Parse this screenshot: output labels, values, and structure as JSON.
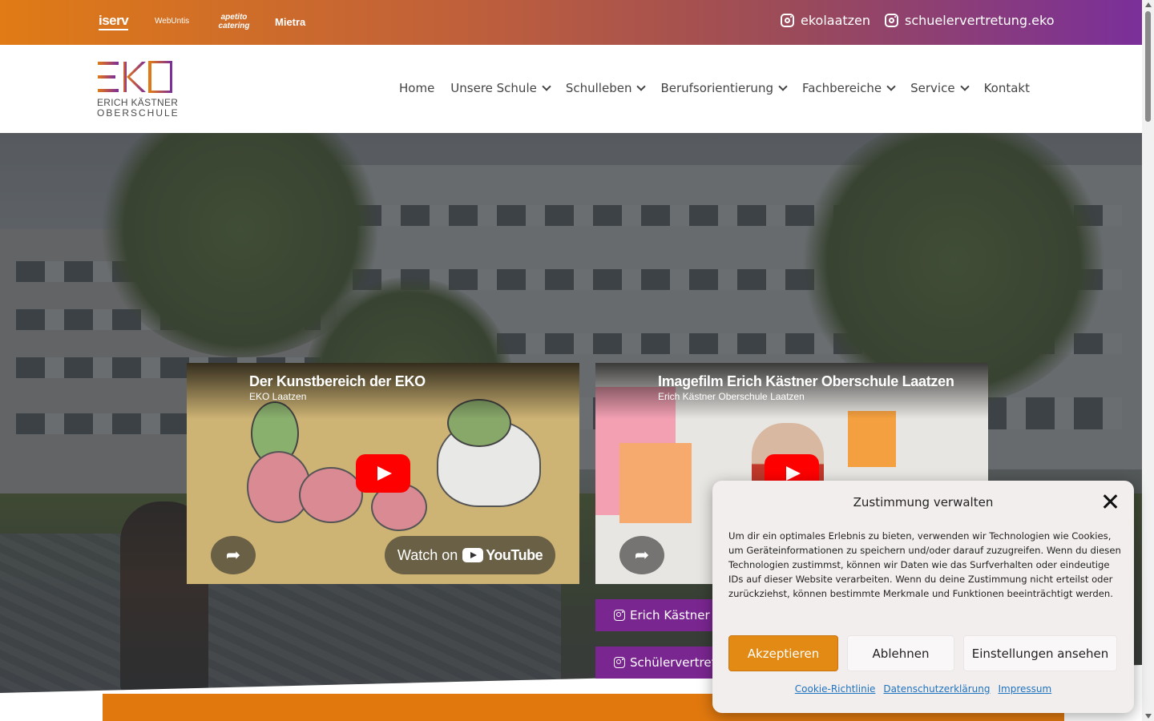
{
  "topbar": {
    "partners": [
      "iserv",
      "WebUntis",
      "apetito catering",
      "Mietra"
    ],
    "social": [
      {
        "label": "ekolaatzen",
        "icon": "instagram-icon"
      },
      {
        "label": "schuelervertretung.eko",
        "icon": "instagram-icon"
      }
    ]
  },
  "logo": {
    "letters": "EKO",
    "line1": "ERICH KÄSTNER",
    "line2": "OBERSCHULE"
  },
  "nav": {
    "items": [
      {
        "label": "Home",
        "dropdown": false
      },
      {
        "label": "Unsere Schule",
        "dropdown": true
      },
      {
        "label": "Schulleben",
        "dropdown": true
      },
      {
        "label": "Berufsorientierung",
        "dropdown": true
      },
      {
        "label": "Fachbereiche",
        "dropdown": true
      },
      {
        "label": "Service",
        "dropdown": true
      },
      {
        "label": "Kontakt",
        "dropdown": false
      }
    ]
  },
  "videos": [
    {
      "title": "Der Kunstbereich der EKO",
      "channel": "EKO Laatzen",
      "watch_label": "Watch on",
      "watch_brand": "YouTube"
    },
    {
      "title": "Imagefilm Erich Kästner Oberschule Laatzen",
      "channel": "Erich Kästner Oberschule Laatzen"
    }
  ],
  "instagram_buttons": [
    "Erich Kästner O",
    "Schülervertret"
  ],
  "cookie": {
    "title": "Zustimmung verwalten",
    "text": "Um dir ein optimales Erlebnis zu bieten, verwenden wir Technologien wie Cookies, um Geräteinformationen zu speichern und/oder darauf zuzugreifen. Wenn du diesen Technologien zustimmst, können wir Daten wie das Surfverhalten oder eindeutige IDs auf dieser Website verarbeiten. Wenn du deine Zustimmung nicht erteilst oder zurückziehst, können bestimmte Merkmale und Funktionen beeinträchtigt werden.",
    "accept": "Akzeptieren",
    "deny": "Ablehnen",
    "settings": "Einstellungen ansehen",
    "links": [
      "Cookie-Richtlinie",
      "Datenschutzerklärung",
      "Impressum"
    ]
  },
  "colors": {
    "brand_orange": "#e0780e",
    "brand_purple": "#7a2690",
    "accept_button": "#e28a14",
    "link": "#1e73be"
  }
}
